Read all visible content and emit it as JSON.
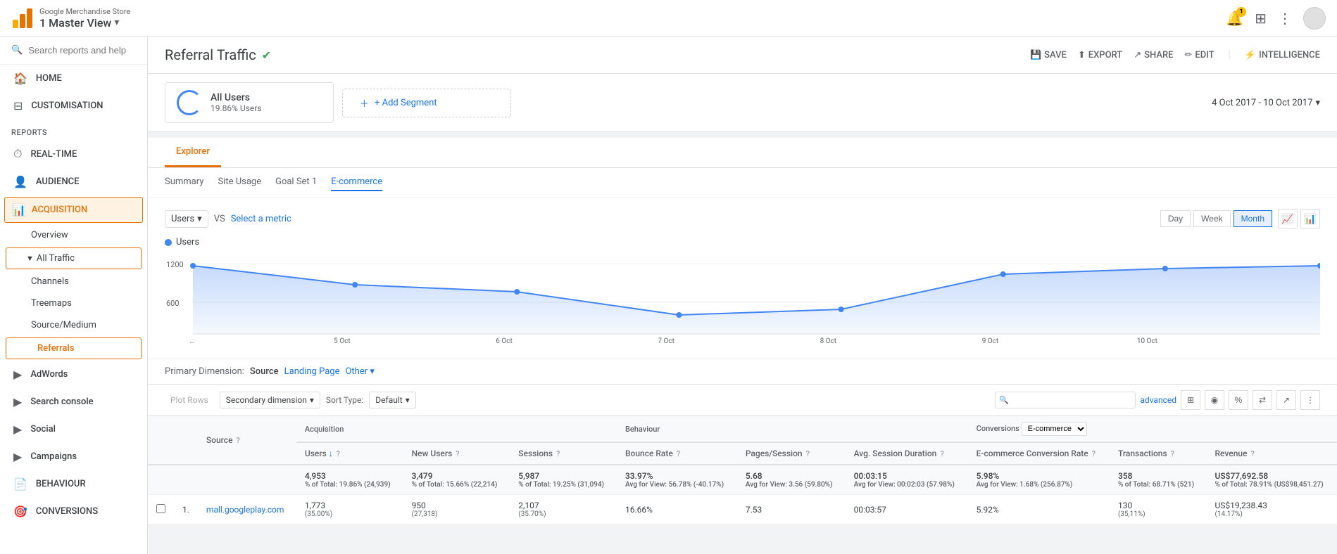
{
  "app": {
    "name": "Google Merchandise Store",
    "view": "1 Master View"
  },
  "topbar": {
    "bell_count": "1",
    "search_placeholder": "Search reports and help"
  },
  "sidebar": {
    "search_placeholder": "Search reports and help",
    "home": "HOME",
    "customisation": "CUSTOMISATION",
    "reports_label": "Reports",
    "realtime": "REAL-TIME",
    "audience": "AUDIENCE",
    "acquisition": "ACQUISITION",
    "acq_overview": "Overview",
    "acq_all_traffic": "All Traffic",
    "acq_channels": "Channels",
    "acq_treemaps": "Treemaps",
    "acq_source_medium": "Source/Medium",
    "acq_referrals": "Referrals",
    "adwords": "AdWords",
    "search_console": "Search console",
    "social": "Social",
    "campaigns": "Campaigns",
    "behaviour": "BEHAVIOUR",
    "conversions": "CONVERSIONS"
  },
  "page": {
    "title": "Referral Traffic",
    "save": "SAVE",
    "export": "EXPORT",
    "share": "SHARE",
    "edit": "EDIT",
    "intelligence": "INTELLIGENCE"
  },
  "segment": {
    "name": "All Users",
    "percent": "19.86% Users",
    "add_label": "+ Add Segment"
  },
  "date_range": {
    "text": "4 Oct 2017 - 10 Oct 2017"
  },
  "explorer": {
    "tab": "Explorer",
    "sub_tabs": [
      "Summary",
      "Site Usage",
      "Goal Set 1",
      "E-commerce"
    ]
  },
  "chart": {
    "metric": "Users",
    "vs_text": "VS",
    "select_metric": "Select a metric",
    "legend": "Users",
    "time_btns": [
      "Day",
      "Week",
      "Month"
    ],
    "active_time": "Month",
    "y_labels": [
      "1200",
      "600"
    ],
    "x_labels": [
      "...",
      "5 Oct",
      "6 Oct",
      "7 Oct",
      "8 Oct",
      "9 Oct",
      "10 Oct"
    ]
  },
  "primary_dimension": {
    "label": "Primary Dimension:",
    "source": "Source",
    "landing_page": "Landing Page",
    "other": "Other"
  },
  "table_toolbar": {
    "plot_rows": "Plot Rows",
    "secondary_dimension": "Secondary dimension",
    "sort_type": "Sort Type:",
    "default": "Default",
    "advanced": "advanced"
  },
  "table": {
    "col_groups": [
      "Acquisition",
      "Behaviour",
      "Conversions"
    ],
    "conversions_label": "Conversions",
    "ecommerce": "E-commerce",
    "headers": {
      "source": "Source",
      "users": "Users",
      "new_users": "New Users",
      "sessions": "Sessions",
      "bounce_rate": "Bounce Rate",
      "pages_session": "Pages/Session",
      "avg_session": "Avg. Session Duration",
      "ecommerce_rate": "E-commerce Conversion Rate",
      "transactions": "Transactions",
      "revenue": "Revenue"
    },
    "totals": {
      "users": "4,953",
      "users_sub": "% of Total: 19.86% (24,939)",
      "new_users": "3,479",
      "new_users_sub": "% of Total: 15.66% (22,214)",
      "sessions": "5,987",
      "sessions_sub": "% of Total: 19.25% (31,094)",
      "bounce_rate": "33.97%",
      "bounce_rate_sub": "Avg for View: 56.78% (-40.17%)",
      "pages_session": "5.68",
      "pages_session_sub": "Avg for View: 3.56 (59.80%)",
      "avg_session": "00:03:15",
      "avg_session_sub": "Avg for View: 00:02:03 (57.98%)",
      "ecommerce_rate": "5.98%",
      "ecommerce_rate_sub": "Avg for View: 1.68% (256.87%)",
      "transactions": "358",
      "transactions_sub": "% of Total: 68.71% (521)",
      "revenue": "US$77,692.58",
      "revenue_sub": "% of Total: 78.91% (US$98,451.27)"
    },
    "rows": [
      {
        "num": "1",
        "source": "mall.googleplay.com",
        "users": "1,773",
        "users_pct": "(35.00%)",
        "new_users": "950",
        "new_users_pct": "(27,318)",
        "sessions": "2,107",
        "sessions_pct": "(35.70%)",
        "bounce_rate": "16.66%",
        "pages_session": "7.53",
        "avg_session": "00:03:57",
        "ecommerce_rate": "5.92%",
        "transactions": "130",
        "transactions_pct": "(35,11%)",
        "revenue": "US$19,238.43",
        "revenue_pct": "(14.17%)"
      }
    ]
  }
}
